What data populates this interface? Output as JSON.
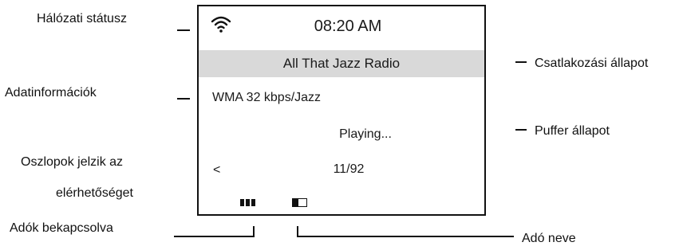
{
  "callouts": {
    "network_status": "Hálózati státusz",
    "data_info": "Adatinformációk",
    "availability_line1": "Oszlopok jelzik az",
    "availability_line2": "elérhetőséget",
    "stations_on": "Adók bekapcsolva",
    "connection_state": "Csatlakozási állapot",
    "buffer_state": "Puffer állapot",
    "station_name": "Adó neve"
  },
  "screen": {
    "wifi_icon": "wifi-icon",
    "time": "08:20 AM",
    "station": "All That Jazz Radio",
    "data_info": "WMA 32 kbps/Jazz",
    "status": "Playing...",
    "prev_arrow": "<",
    "preset_counter": "11/92",
    "signal_level": 1.0,
    "station_icon": "station-indicator-icon"
  },
  "colors": {
    "highlight_bar": "#d9d9d9",
    "line": "#111111"
  }
}
